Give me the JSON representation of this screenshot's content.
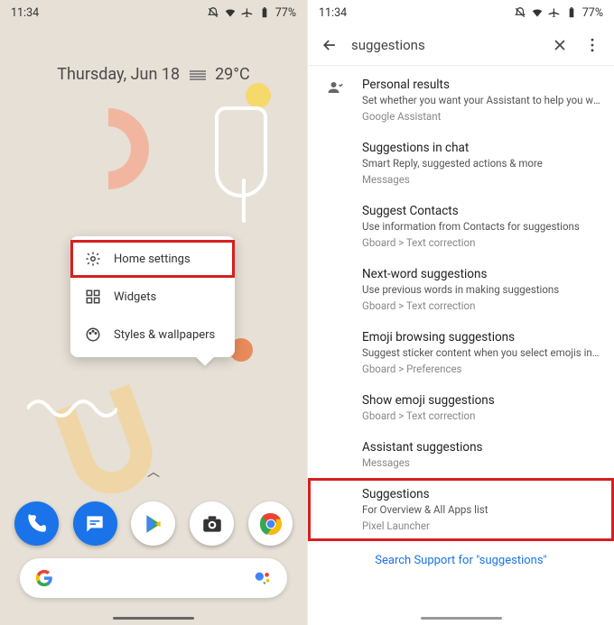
{
  "status": {
    "time": "11:34",
    "battery": "77%"
  },
  "home": {
    "date": "Thursday, Jun 18",
    "temp": "29°C",
    "menu": [
      "Home settings",
      "Widgets",
      "Styles & wallpapers"
    ]
  },
  "search": {
    "query": "suggestions",
    "results": [
      {
        "title": "Personal results",
        "desc": "Set whether you want your Assistant to help you with y..",
        "path": "Google Assistant"
      },
      {
        "title": "Suggestions in chat",
        "desc": "Smart Reply, suggested actions & more",
        "path": "Messages"
      },
      {
        "title": "Suggest Contacts",
        "desc": "Use information from Contacts for suggestions",
        "path": "Gboard > Text correction"
      },
      {
        "title": "Next-word suggestions",
        "desc": "Use previous words in making suggestions",
        "path": "Gboard > Text correction"
      },
      {
        "title": "Emoji browsing suggestions",
        "desc": "Suggest sticker content when you select emojis in the..",
        "path": "Gboard > Preferences"
      },
      {
        "title": "Show emoji suggestions",
        "desc": "",
        "path": "Gboard > Text correction"
      },
      {
        "title": "Assistant suggestions",
        "desc": "",
        "path": "Messages"
      },
      {
        "title": "Suggestions",
        "desc": "For Overview & All Apps list",
        "path": "Pixel Launcher"
      }
    ],
    "support": "Search Support for \"suggestions\""
  }
}
